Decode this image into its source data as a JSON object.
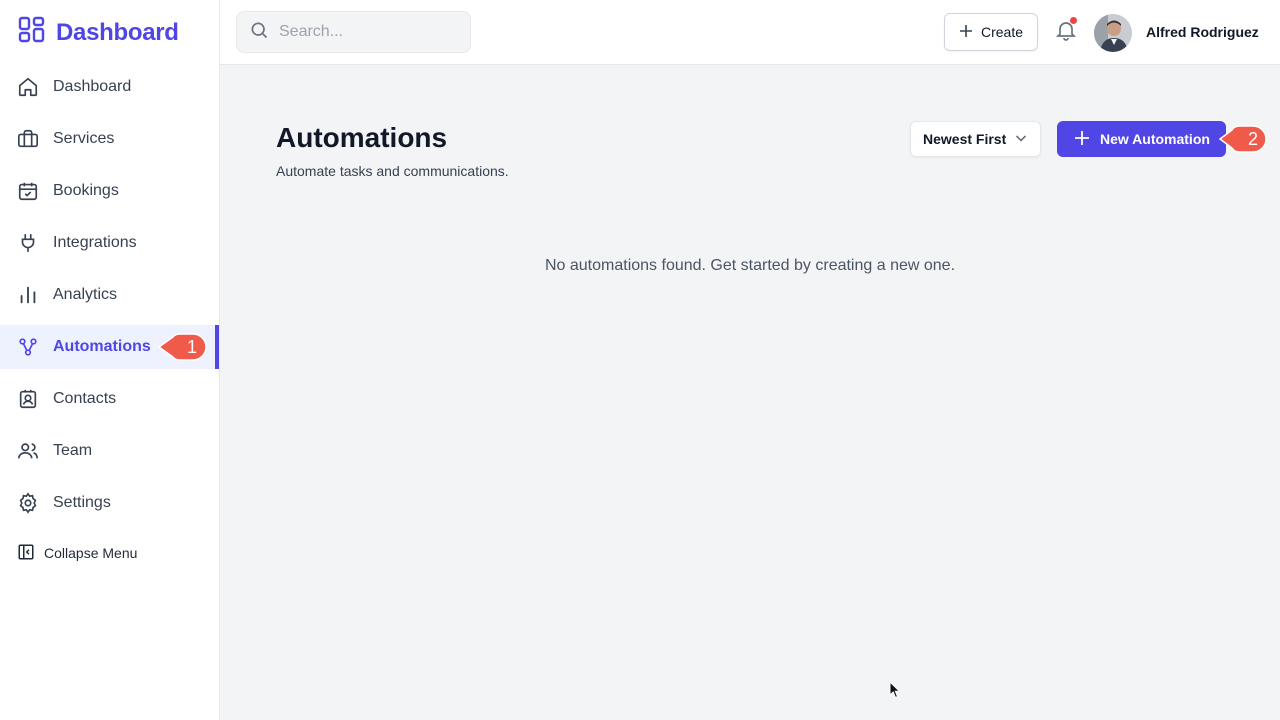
{
  "brand": {
    "title": "Dashboard",
    "color": "#4f46e5"
  },
  "sidebar": {
    "items": [
      {
        "label": "Dashboard",
        "icon": "home-icon"
      },
      {
        "label": "Services",
        "icon": "briefcase-icon"
      },
      {
        "label": "Bookings",
        "icon": "calendar-check-icon"
      },
      {
        "label": "Integrations",
        "icon": "plug-icon"
      },
      {
        "label": "Analytics",
        "icon": "bar-chart-icon"
      },
      {
        "label": "Automations",
        "icon": "workflow-icon",
        "active": true
      },
      {
        "label": "Contacts",
        "icon": "contact-card-icon"
      },
      {
        "label": "Team",
        "icon": "users-icon"
      },
      {
        "label": "Settings",
        "icon": "gear-icon"
      }
    ],
    "collapse_label": "Collapse Menu"
  },
  "topbar": {
    "search_placeholder": "Search...",
    "create_label": "Create",
    "user_name": "Alfred Rodriguez"
  },
  "main": {
    "title": "Automations",
    "subtitle": "Automate tasks and communications.",
    "sort_label": "Newest First",
    "new_button_label": "New Automation",
    "empty_message": "No automations found. Get started by creating a new one."
  },
  "annotations": [
    {
      "number": "1",
      "target": "Automations"
    },
    {
      "number": "2",
      "target": "New Automation"
    }
  ],
  "colors": {
    "accent": "#4f46e5",
    "annotation": "#ef5a4a",
    "notification": "#ef4444"
  }
}
